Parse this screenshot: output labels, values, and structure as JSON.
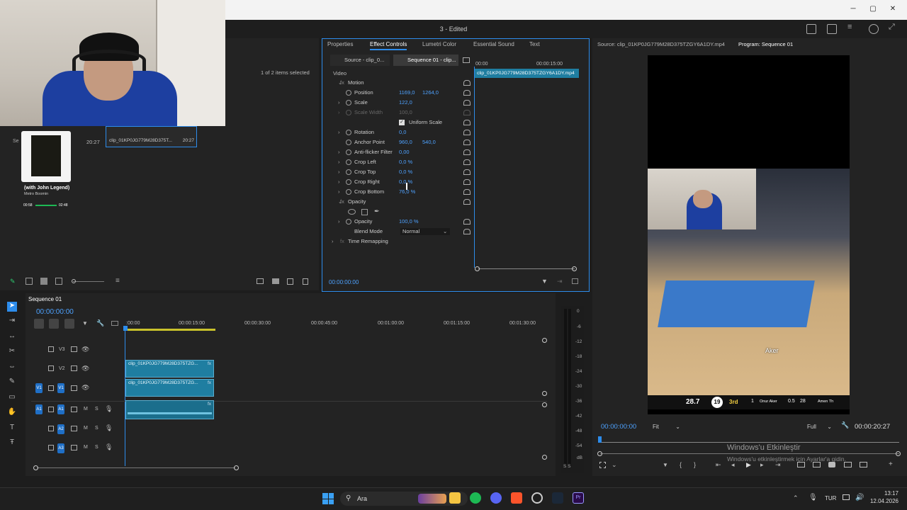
{
  "window": {
    "title": "3 - Edited",
    "minimize": "─",
    "maximize": "▢",
    "close": "✕"
  },
  "project": {
    "items_selected": "1 of 2 items selected",
    "clip_name": "clip_01KP0JG779M28D375T...",
    "clip_duration": "20:27",
    "left_duration": "20:27",
    "left_label": "Se",
    "music": {
      "title": "(with John Legend)",
      "artist": "Metro Boomin",
      "time_start": "00:58",
      "time_end": "02:48"
    }
  },
  "effect_controls": {
    "tabs": [
      "Properties",
      "Effect Controls",
      "Lumetri Color",
      "Essential Sound",
      "Text"
    ],
    "active_tab": "Effect Controls",
    "source_dropdown": "Source - clip_0...",
    "sequence_dropdown": "Sequence 01 - clip...",
    "ruler_start": "00:00",
    "ruler_mid": "00:00:15:00",
    "clip_bar": "clip_01KP0JG779M28D375TZGY6A1DY.mp4",
    "section_video": "Video",
    "motion": "Motion",
    "position": {
      "label": "Position",
      "x": "1169,0",
      "y": "1264,0"
    },
    "scale": {
      "label": "Scale",
      "value": "122,0"
    },
    "scale_width": {
      "label": "Scale Width",
      "value": "100,0"
    },
    "uniform_scale": "Uniform Scale",
    "rotation": {
      "label": "Rotation",
      "value": "0,0"
    },
    "anchor": {
      "label": "Anchor Point",
      "x": "960,0",
      "y": "540,0"
    },
    "antiflicker": {
      "label": "Anti-flicker Filter",
      "value": "0,00"
    },
    "crop_left": {
      "label": "Crop Left",
      "value": "0,0 %"
    },
    "crop_top": {
      "label": "Crop Top",
      "value": "0,0 %"
    },
    "crop_right": {
      "label": "Crop Right",
      "value": "0,0 %"
    },
    "crop_bottom": {
      "label": "Crop Bottom",
      "value": "76,0 %"
    },
    "opacity_section": "Opacity",
    "opacity": {
      "label": "Opacity",
      "value": "100,0 %"
    },
    "blend_mode": {
      "label": "Blend Mode",
      "value": "Normal"
    },
    "time_remap": "Time Remapping",
    "timecode": "00:00:00:00"
  },
  "timeline": {
    "sequence_name": "Sequence 01",
    "timecode": "00:00:00:00",
    "ruler": [
      ":00:00",
      "00:00:15:00",
      "00:00:30:00",
      "00:00:45:00",
      "00:01:00:00",
      "00:01:15:00",
      "00:01:30:00"
    ],
    "tracks": [
      "V3",
      "V2",
      "V1",
      "A1",
      "A2",
      "A3"
    ],
    "source_v": "V1",
    "source_a": "A1",
    "clip_v2": "clip_01KP0JG779M28D375TZG...",
    "clip_v1": "clip_01KP0JG779M28D375TZG...",
    "fx": "fx",
    "meter_labels": [
      "0",
      "-6",
      "-12",
      "-18",
      "-24",
      "-30",
      "-36",
      "-42",
      "-48",
      "-54"
    ],
    "meter_unit": "dB",
    "meter_s": "S S",
    "m": "M",
    "s": "S"
  },
  "program": {
    "source_label": "Source: clip_01KP0JG779M28D375TZGY6A1DY.mp4",
    "program_label": "Program: Sequence 01",
    "timecode_left": "00:00:00:00",
    "fit": "Fit",
    "quality": "Full",
    "timecode_right": "00:00:20:27",
    "score_left": "28.7",
    "shot_clock": "19",
    "quarter": "3rd",
    "player1": "Onur Aker",
    "player1_stat": "0.5",
    "player2": "Amen Th",
    "num1": "1",
    "num2": "28",
    "player_tag": "Aker",
    "watermark1": "Windows'u Etkinleştir",
    "watermark2": "Windows'u etkinleştirmek için Ayarlar'a gidin."
  },
  "taskbar": {
    "search": "Ara",
    "lang": "TUR",
    "time": "13:17",
    "date": "12.04.2026"
  },
  "colors": {
    "accent": "#2d8ceb",
    "clip": "#1f7ea1",
    "value": "#4ea2ff"
  }
}
